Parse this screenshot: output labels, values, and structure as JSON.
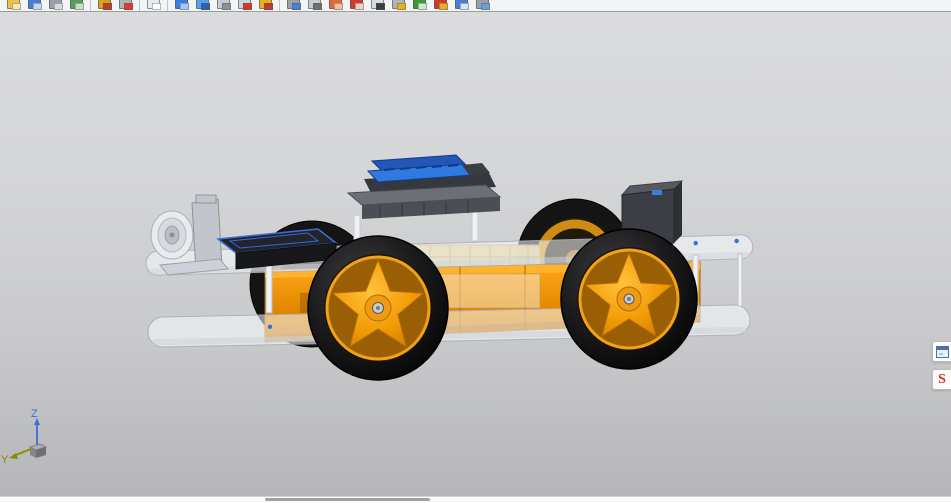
{
  "colors": {
    "accent-orange": "#ef9400",
    "accent-blue": "#2f7ae0",
    "tab-s-red": "#d2301c",
    "axis-z": "#3a6fd6",
    "axis-y": "#8a8a00"
  },
  "toolbar": {
    "icons": [
      {
        "name": "open-icon",
        "c1": "#e8c24a",
        "c2": "#f5e9b0"
      },
      {
        "name": "save-icon",
        "c1": "#4a7fd0",
        "c2": "#c8d8f0"
      },
      {
        "name": "print-icon",
        "c1": "#9aa0a8",
        "c2": "#d8dce0"
      },
      {
        "name": "undo-icon",
        "c1": "#5a9a5a",
        "c2": "#c8e0c8"
      },
      {
        "sep": true
      },
      {
        "name": "sketch-icon",
        "c1": "#d8a020",
        "c2": "#c03a2a"
      },
      {
        "name": "smart-dimension-icon",
        "c1": "#b0b4b8",
        "c2": "#e03a2a"
      },
      {
        "sep": true
      },
      {
        "name": "select-box-icon",
        "c1": "#e8eaec",
        "c2": "#ffffff"
      },
      {
        "sep": true
      },
      {
        "name": "view-orientation-icon",
        "c1": "#3a7fe0",
        "c2": "#a8c8f0"
      },
      {
        "name": "shaded-cube-icon",
        "c1": "#5aa0e8",
        "c2": "#2a60b0"
      },
      {
        "name": "hidden-lines-icon",
        "c1": "#c8ccd0",
        "c2": "#8a9098"
      },
      {
        "name": "zoom-area-icon",
        "c1": "#d0d4d8",
        "c2": "#d03a2a"
      },
      {
        "name": "measure-icon",
        "c1": "#e8b020",
        "c2": "#c03a2a"
      },
      {
        "sep": true
      },
      {
        "name": "section-view-icon",
        "c1": "#9aa0a8",
        "c2": "#4a7fd0"
      },
      {
        "name": "curvature-icon",
        "c1": "#c8ccd0",
        "c2": "#6a7078"
      },
      {
        "name": "appearance-icon",
        "c1": "#e06a3a",
        "c2": "#f0c0a0"
      },
      {
        "name": "edit-appearance-icon",
        "c1": "#d03a2a",
        "c2": "#f0d0c0"
      },
      {
        "name": "evaluate-clock-icon",
        "c1": "#d8dce0",
        "c2": "#3a3e44"
      },
      {
        "name": "tolerance-icon",
        "c1": "#b0b4b8",
        "c2": "#e8b020"
      },
      {
        "name": "check-icon",
        "c1": "#3a9a3a",
        "c2": "#d0e8d0"
      },
      {
        "name": "pencil-icon",
        "c1": "#d03a2a",
        "c2": "#e8b020"
      },
      {
        "name": "rebuild-icon",
        "c1": "#4a7fd0",
        "c2": "#d8e4f4"
      },
      {
        "name": "speaker-icon",
        "c1": "#9aa0a8",
        "c2": "#6aa0d8"
      }
    ]
  },
  "viewport": {
    "triad": {
      "z_label": "Z",
      "y_label": "Y"
    }
  },
  "task_pane": {
    "solidworks_tab_label": "S"
  }
}
